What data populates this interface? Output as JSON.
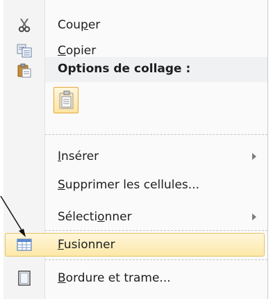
{
  "menu": {
    "items": [
      {
        "id": "cut",
        "before": "Cou",
        "mnemonic": "p",
        "after": "er",
        "icon": "scissors-icon",
        "submenu": false
      },
      {
        "id": "copy",
        "before": "",
        "mnemonic": "C",
        "after": "opier",
        "icon": "copy-icon",
        "submenu": false
      },
      {
        "id": "insert",
        "before": "",
        "mnemonic": "I",
        "after": "nsérer",
        "icon": "",
        "submenu": true
      },
      {
        "id": "delete",
        "before": "",
        "mnemonic": "S",
        "after": "upprimer les cellules...",
        "icon": "",
        "submenu": false
      },
      {
        "id": "select",
        "before": "Sélecti",
        "mnemonic": "o",
        "after": "nner",
        "icon": "",
        "submenu": true
      },
      {
        "id": "merge",
        "before": "",
        "mnemonic": "F",
        "after": "usionner",
        "icon": "merge-table-icon",
        "submenu": false,
        "highlighted": true
      },
      {
        "id": "borders",
        "before": "",
        "mnemonic": "B",
        "after": "ordure et trame...",
        "icon": "border-page-icon",
        "submenu": false
      }
    ],
    "paste_header": "Options de collage :",
    "paste_option_icon": "paste-document-icon"
  },
  "colors": {
    "highlight_border": "#e5c365",
    "highlight_fill": "#fde8a8",
    "paste_box_border": "#e3a63c"
  }
}
